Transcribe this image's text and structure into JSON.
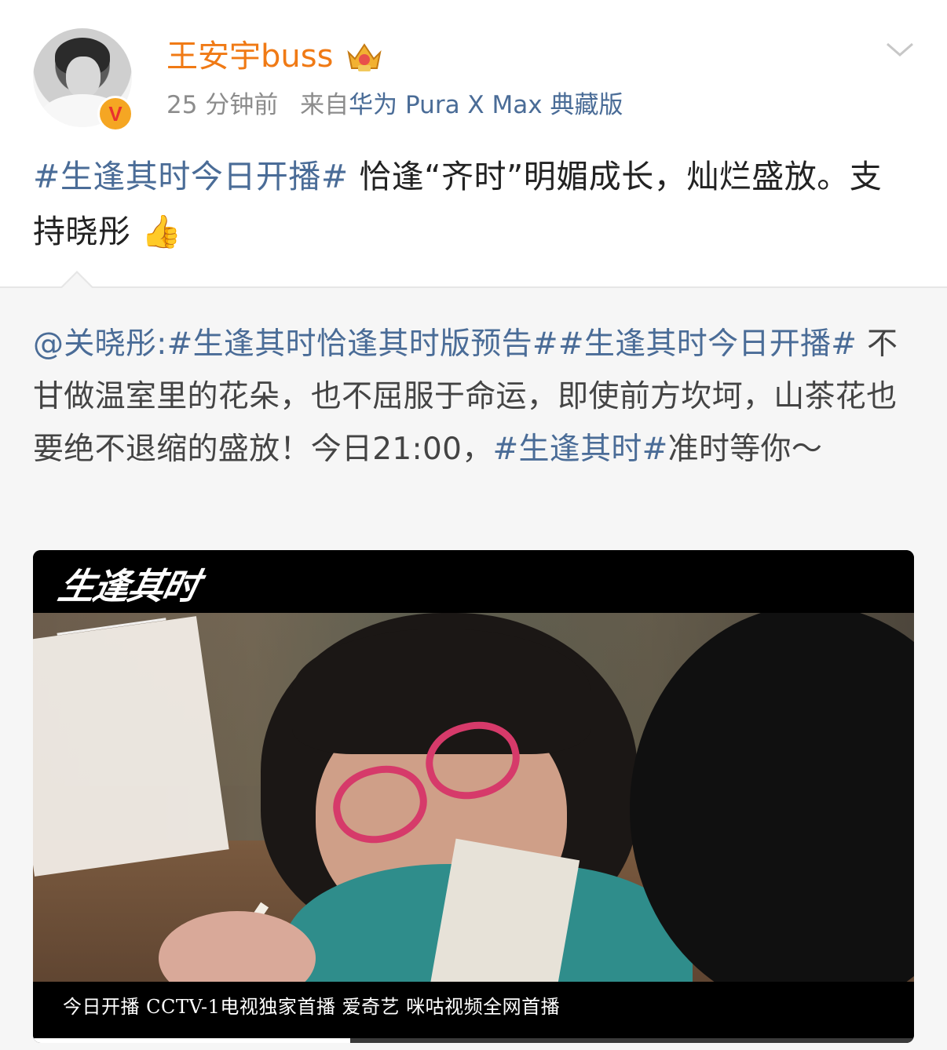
{
  "post": {
    "username": "王安宇buss",
    "time": "25 分钟前",
    "source_prefix": "来自",
    "source": "华为 Pura X Max 典藏版",
    "text_hashtag": "#生逢其时今日开播#",
    "text_body": " 恰逢“齐时”明媚成长，灿烂盛放。支持晓彤",
    "emoji": "👍"
  },
  "repost": {
    "mention": "@关晓彤",
    "colon": ":",
    "hashtag_1": "#生逢其时恰逢其时版预告#",
    "hashtag_2": "#生逢其时今日开播#",
    "body_1": " 不甘做温室里的花朵，也不屈服于命运，即使前方坎坷，山茶花也要绝不退缩的盛放！今日21:00，",
    "hashtag_3": "#生逢其时#",
    "body_2": "准时等你～"
  },
  "video": {
    "logo_text": "生逢其时",
    "caption": "今日开播 CCTV-1电视独家首播 爱奇艺 咪咕视频全网首播",
    "progress": 0.36
  },
  "colors": {
    "username": "#f07a15",
    "link": "#4a6c97",
    "verified_badge": "#f5a623"
  },
  "icons": {
    "verified": "verified-v-icon",
    "vip": "vip-crown-icon",
    "menu": "chevron-down-icon",
    "emoji": "thumbs-up-icon"
  }
}
